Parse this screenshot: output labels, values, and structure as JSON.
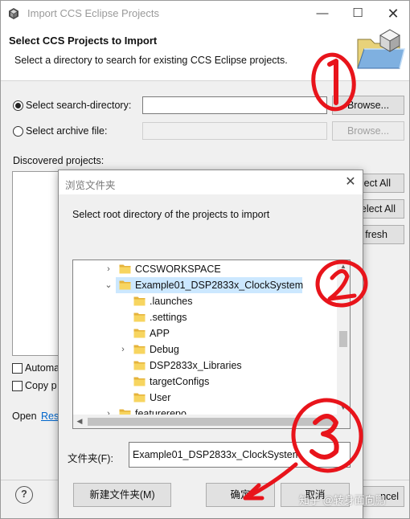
{
  "window": {
    "title": "Import CCS Eclipse Projects",
    "minimize_glyph": "—",
    "maximize_glyph": "☐",
    "close_glyph": "✕"
  },
  "header": {
    "title": "Select CCS Projects to Import",
    "description": "Select a directory to search for existing CCS Eclipse projects."
  },
  "form": {
    "search_directory_label": "Select search-directory:",
    "search_directory_value": "",
    "search_directory_selected": true,
    "browse_label": "Browse...",
    "archive_label": "Select archive file:",
    "archive_value": "",
    "archive_browse_label": "Browse...",
    "discovered_label": "Discovered projects:",
    "select_all_partial": "ect All",
    "deselect_all_partial": "elect All",
    "refresh_partial": "fresh",
    "auto_partial": "Automa",
    "copy_partial": "Copy p",
    "open_partial": "Open",
    "open_link_partial": "Res",
    "help_glyph": "?",
    "cancel_partial": "ncel"
  },
  "dialog": {
    "title": "浏览文件夹",
    "close_glyph": "✕",
    "prompt": "Select root directory of the projects to import",
    "folder_label": "文件夹(F):",
    "folder_value": "Example01_DSP2833x_ClockSystem",
    "new_folder_button": "新建文件夹(M)",
    "ok_button": "确定",
    "cancel_button": "取消",
    "tree": [
      {
        "name": "CCSWORKSPACE",
        "level": 0,
        "expander": "›",
        "selected": false
      },
      {
        "name": "Example01_DSP2833x_ClockSystem",
        "level": 0,
        "expander": "⌄",
        "selected": true
      },
      {
        "name": ".launches",
        "level": 1,
        "expander": "",
        "selected": false
      },
      {
        "name": ".settings",
        "level": 1,
        "expander": "",
        "selected": false
      },
      {
        "name": "APP",
        "level": 1,
        "expander": "",
        "selected": false
      },
      {
        "name": "Debug",
        "level": 1,
        "expander": "›",
        "selected": false
      },
      {
        "name": "DSP2833x_Libraries",
        "level": 1,
        "expander": "",
        "selected": false
      },
      {
        "name": "targetConfigs",
        "level": 1,
        "expander": "",
        "selected": false
      },
      {
        "name": "User",
        "level": 1,
        "expander": "",
        "selected": false
      },
      {
        "name": "featurerepo",
        "level": 0,
        "expander": "›",
        "selected": false
      }
    ]
  },
  "annotations": {
    "color": "#e8141b",
    "step1": "①",
    "step2": "②",
    "step3": "③"
  },
  "watermark": "知乎 @转身面向鹏",
  "colors": {
    "selection": "#cce8ff",
    "folder_yellow": "#f7d560",
    "folder_dark": "#e5b33b"
  }
}
